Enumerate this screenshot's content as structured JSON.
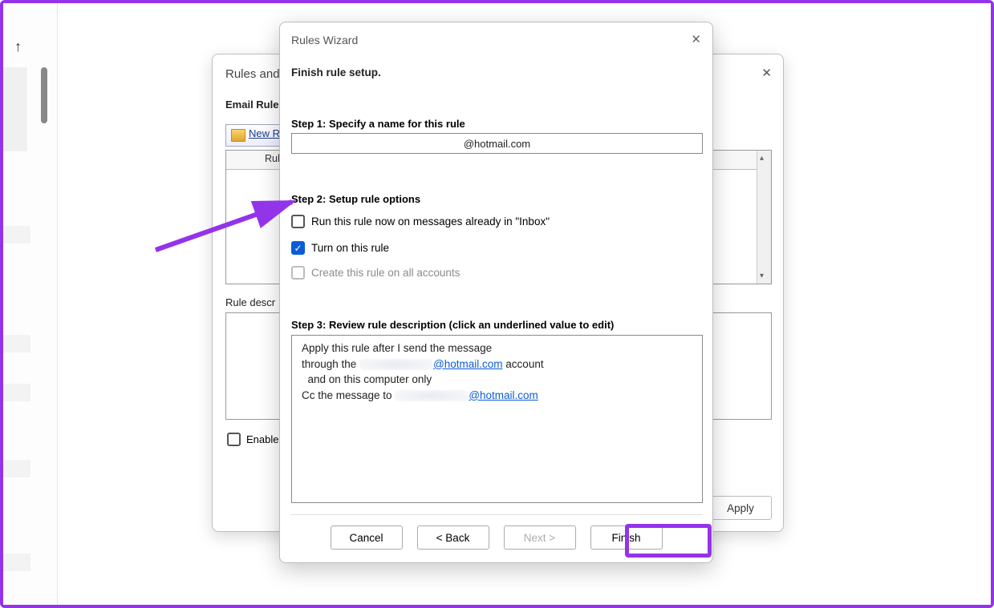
{
  "background_dialog": {
    "title": "Rules and A",
    "tab_label": "Email Rules",
    "new_rule_button": "New R",
    "rule_column_header": "Rule (a",
    "rule_desc_label": "Rule descr",
    "enable_label": "Enable",
    "apply_button": "Apply"
  },
  "wizard": {
    "title": "Rules Wizard",
    "heading": "Finish rule setup.",
    "step1_label": "Step 1: Specify a name for this rule",
    "rule_name_value": "@hotmail.com",
    "step2_label": "Step 2: Setup rule options",
    "opt_run_now": "Run this rule now on messages already in \"Inbox\"",
    "opt_turn_on": "Turn on this rule",
    "opt_all_accounts": "Create this rule on all accounts",
    "step3_label": "Step 3: Review rule description (click an underlined value to edit)",
    "desc_line1": "Apply this rule after I send the message",
    "desc_line2_a": "through the ",
    "desc_line2_link": "@hotmail.com",
    "desc_line2_b": " account",
    "desc_line3": "  and on this computer only",
    "desc_line4_a": "Cc the message to ",
    "desc_line4_link": "@hotmail.com",
    "cancel": "Cancel",
    "back": "< Back",
    "next": "Next >",
    "finish": "Finish"
  },
  "colors": {
    "annotation": "#9333ea"
  }
}
